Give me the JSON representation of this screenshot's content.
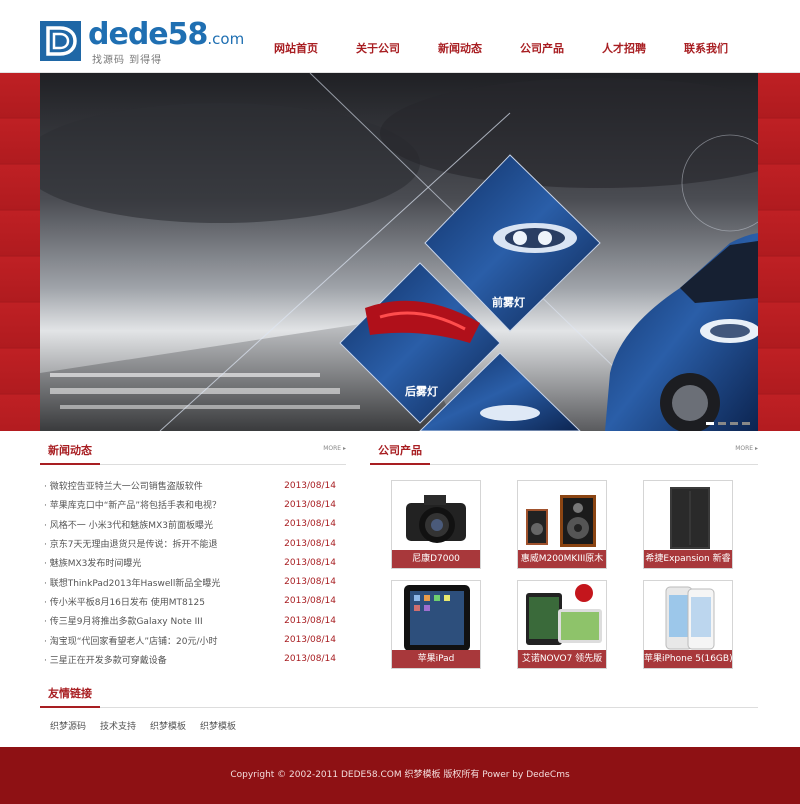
{
  "header": {
    "logo_text": "dede58",
    "logo_suffix": ".com",
    "logo_slogan": "找源码 到得得",
    "nav": [
      "网站首页",
      "关于公司",
      "新闻动态",
      "公司产品",
      "人才招聘",
      "联系我们"
    ]
  },
  "banner": {
    "label_front": "前雾灯",
    "label_rear": "后雾灯",
    "slides": 4,
    "active_slide": 1
  },
  "news": {
    "title": "新闻动态",
    "more": "MORE ▸",
    "items": [
      {
        "title": "· 微软控告亚特兰大一公司销售盗版软件",
        "date": "2013/08/14"
      },
      {
        "title": "· 苹果库克口中“新产品”将包括手表和电视？",
        "date": "2013/08/14"
      },
      {
        "title": "· 风格不一 小米3代和魅族MX3前面板曝光",
        "date": "2013/08/14"
      },
      {
        "title": "· 京东7天无理由退货只是传说：拆开不能退",
        "date": "2013/08/14"
      },
      {
        "title": "· 魅族MX3发布时间曝光",
        "date": "2013/08/14"
      },
      {
        "title": "· 联想ThinkPad2013年Haswell新品全曝光",
        "date": "2013/08/14"
      },
      {
        "title": "· 传小米平板8月16日发布 使用MT8125",
        "date": "2013/08/14"
      },
      {
        "title": "· 传三星9月将推出多款Galaxy Note III",
        "date": "2013/08/14"
      },
      {
        "title": "· 淘宝现“代回家看望老人”店铺：20元/小时",
        "date": "2013/08/14"
      },
      {
        "title": "· 三星正在开发多款可穿戴设备",
        "date": "2013/08/14"
      }
    ]
  },
  "products": {
    "title": "公司产品",
    "more": "MORE ▸",
    "items": [
      {
        "name": "尼康D7000"
      },
      {
        "name": "惠威M200MKIII原木"
      },
      {
        "name": "希捷Expansion 新睿"
      },
      {
        "name": "苹果iPad"
      },
      {
        "name": "艾诺NOVO7 领先版"
      },
      {
        "name": "苹果iPhone 5(16GB)"
      }
    ]
  },
  "links": {
    "title": "友情链接",
    "items": [
      "织梦源码",
      "技术支持",
      "织梦模板",
      "织梦模板"
    ]
  },
  "footer": {
    "copyright": "Copyright © 2002-2011 DEDE58.COM 织梦模板 版权所有 Power by DedeCms"
  },
  "colors": {
    "brand_red": "#a81e22",
    "logo_blue": "#1f67a6",
    "footer_bg": "#8e1114"
  }
}
